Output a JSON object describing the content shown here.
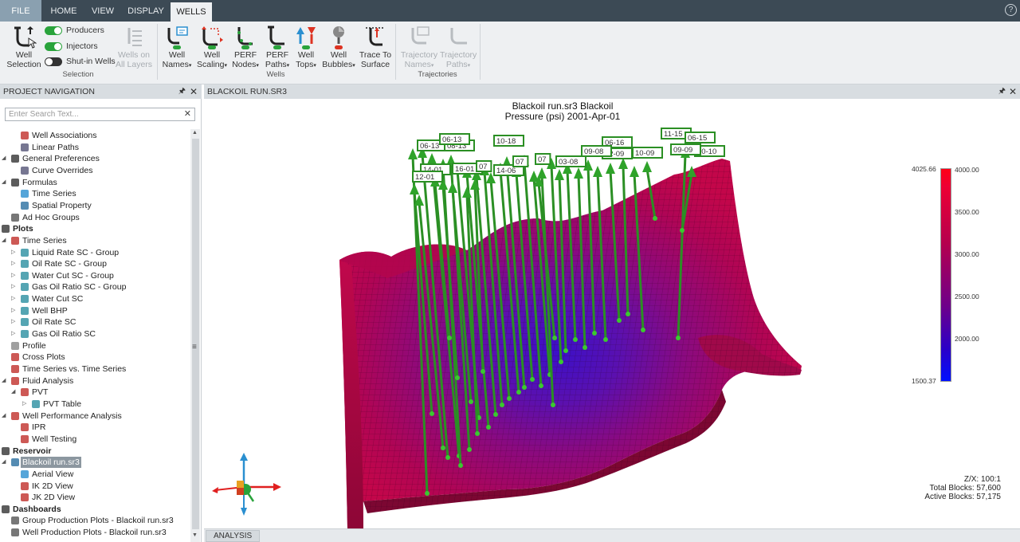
{
  "tabs": [
    {
      "label": "FILE"
    },
    {
      "label": "HOME"
    },
    {
      "label": "VIEW"
    },
    {
      "label": "DISPLAY"
    },
    {
      "label": "WELLS"
    }
  ],
  "help_icon": "?",
  "ribbon": {
    "selection": {
      "well_selection": "Well\nSelection",
      "producers": "Producers",
      "injectors": "Injectors",
      "shutin": "Shut-in Wells",
      "producers_on": true,
      "injectors_on": true,
      "shutin_on": false,
      "wells_on_all_layers": "Wells on\nAll Layers",
      "group": "Selection"
    },
    "wells": {
      "names": "Well\nNames",
      "scaling": "Well\nScaling",
      "perf_nodes": "PERF\nNodes",
      "perf_paths": "PERF\nPaths",
      "tops": "Well\nTops",
      "bubbles": "Well\nBubbles",
      "trace": "Trace To\nSurface",
      "group": "Wells"
    },
    "trajectories": {
      "names": "Trajectory\nNames",
      "paths": "Trajectory\nPaths",
      "group": "Trajectories"
    }
  },
  "left_panel": {
    "title": "PROJECT NAVIGATION",
    "search_placeholder": "Enter Search Text...",
    "items": [
      {
        "label": "Well Associations",
        "icon": "well-association-icon"
      },
      {
        "label": "Linear Paths",
        "icon": "linear-path-icon"
      },
      {
        "label": "General Preferences",
        "icon": "wrench-icon"
      },
      {
        "label": "Curve Overrides",
        "icon": "curve-override-icon"
      },
      {
        "label": "Formulas",
        "icon": "formula-icon"
      },
      {
        "label": "Time Series",
        "icon": "clock-icon"
      },
      {
        "label": "Spatial Property",
        "icon": "cube-icon"
      },
      {
        "label": "Ad Hoc Groups",
        "icon": "adhoc-group-icon"
      },
      {
        "label": "Plots",
        "icon": "folder-icon"
      },
      {
        "label": "Time Series",
        "icon": "clock-icon"
      },
      {
        "label": "Liquid Rate SC - Group",
        "icon": "series-icon"
      },
      {
        "label": "Oil Rate SC - Group",
        "icon": "series-icon"
      },
      {
        "label": "Water Cut SC - Group",
        "icon": "series-icon"
      },
      {
        "label": "Gas Oil Ratio SC - Group",
        "icon": "series-icon"
      },
      {
        "label": "Water Cut SC",
        "icon": "series-icon"
      },
      {
        "label": "Well BHP",
        "icon": "series-icon"
      },
      {
        "label": "Oil Rate SC",
        "icon": "series-icon"
      },
      {
        "label": "Gas Oil Ratio SC",
        "icon": "series-icon"
      },
      {
        "label": "Profile",
        "icon": "profile-icon"
      },
      {
        "label": "Cross Plots",
        "icon": "cross-plot-icon"
      },
      {
        "label": "Time Series vs. Time Series",
        "icon": "ts-vs-ts-icon"
      },
      {
        "label": "Fluid Analysis",
        "icon": "flask-icon"
      },
      {
        "label": "PVT",
        "icon": "pvt-icon"
      },
      {
        "label": "PVT Table",
        "icon": "series-icon"
      },
      {
        "label": "Well Performance Analysis",
        "icon": "gauge-icon"
      },
      {
        "label": "IPR",
        "icon": "ipr-icon"
      },
      {
        "label": "Well Testing",
        "icon": "well-testing-icon"
      },
      {
        "label": "Reservoir",
        "icon": "folder-icon"
      },
      {
        "label": "Blackoil run.sr3",
        "icon": "reservoir-icon"
      },
      {
        "label": "Aerial View",
        "icon": "aerial-view-icon"
      },
      {
        "label": "IK 2D View",
        "icon": "ik-view-icon"
      },
      {
        "label": "JK 2D View",
        "icon": "jk-view-icon"
      },
      {
        "label": "Dashboards",
        "icon": "folder-icon"
      },
      {
        "label": "Group Production Plots - Blackoil run.sr3",
        "icon": "dashboard-icon"
      },
      {
        "label": "Well Production Plots - Blackoil run.sr3",
        "icon": "dashboard-icon"
      }
    ]
  },
  "main": {
    "tab_title": "BLACKOIL RUN.SR3",
    "title_line1": "Blackoil run.sr3 Blackoil",
    "title_line2": "Pressure (psi)  2001-Apr-01",
    "colorbar": {
      "max_label": "4025.66",
      "min_label": "1500.37",
      "ticks": [
        "4000.00",
        "3500.00",
        "3000.00",
        "2500.00",
        "2000.00"
      ],
      "top_color": "#ff0016",
      "bottom_color": "#0010ff"
    },
    "well_labels": [
      "06-13",
      "08-13",
      "06-13",
      "10-18",
      "06-16",
      "11-15",
      "06-15",
      "10-10",
      "09-09",
      "10-09",
      "12-09",
      "09-08",
      "03-08",
      "07",
      "14-06",
      "16-01",
      "14-01",
      "12-01",
      "07",
      "07"
    ],
    "stats": {
      "zx": "Z/X: 100:1",
      "total_blocks": "Total Blocks: 57,600",
      "active_blocks": "Active Blocks: 57,175"
    }
  },
  "bottom_tabs": [
    {
      "label": "ANALYSIS"
    }
  ]
}
